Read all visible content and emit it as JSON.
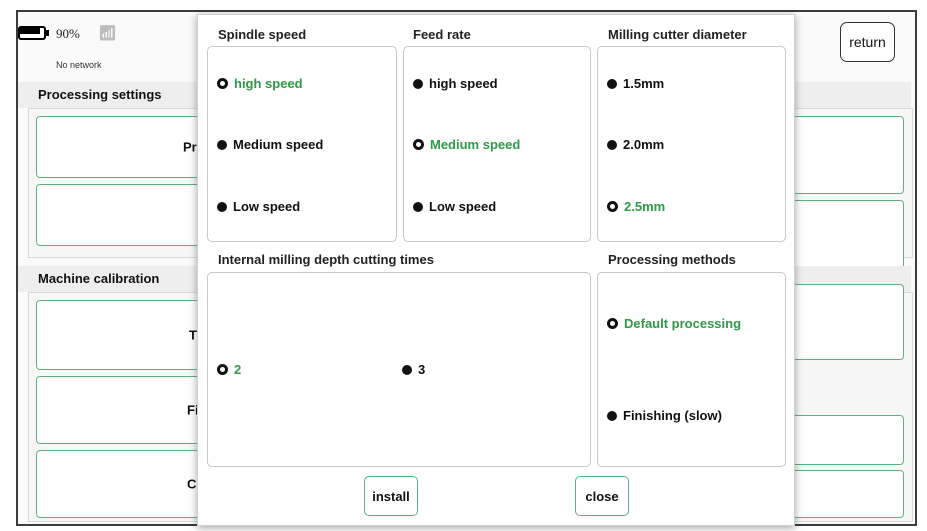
{
  "status": {
    "battery_percent": "90%",
    "battery_level": 0.9,
    "network": "No network",
    "wifi_icon": "wifi-icon"
  },
  "header": {
    "return_label": "return"
  },
  "sections": {
    "processing_settings": "Processing settings",
    "machine_calibration": "Machine calibration"
  },
  "background_cards": {
    "left": [
      "Pr",
      "",
      "T",
      "Fi",
      "C"
    ]
  },
  "modal": {
    "spindle": {
      "title": "Spindle speed",
      "options": [
        "high speed",
        "Medium speed",
        "Low speed"
      ],
      "selected": 0
    },
    "feed": {
      "title": "Feed rate",
      "options": [
        "high speed",
        "Medium speed",
        "Low speed"
      ],
      "selected": 1
    },
    "cutter": {
      "title": "Milling cutter diameter",
      "options": [
        "1.5mm",
        "2.0mm",
        "2.5mm"
      ],
      "selected": 2
    },
    "depth": {
      "title": "Internal milling depth cutting times",
      "options": [
        "2",
        "3"
      ],
      "selected": 0
    },
    "methods": {
      "title": "Processing methods",
      "options": [
        "Default processing",
        "Finishing (slow)"
      ],
      "selected": 0
    },
    "install_label": "install",
    "close_label": "close"
  },
  "colors": {
    "accent_green": "#2e9a4a",
    "card_border": "#5fb27e"
  }
}
